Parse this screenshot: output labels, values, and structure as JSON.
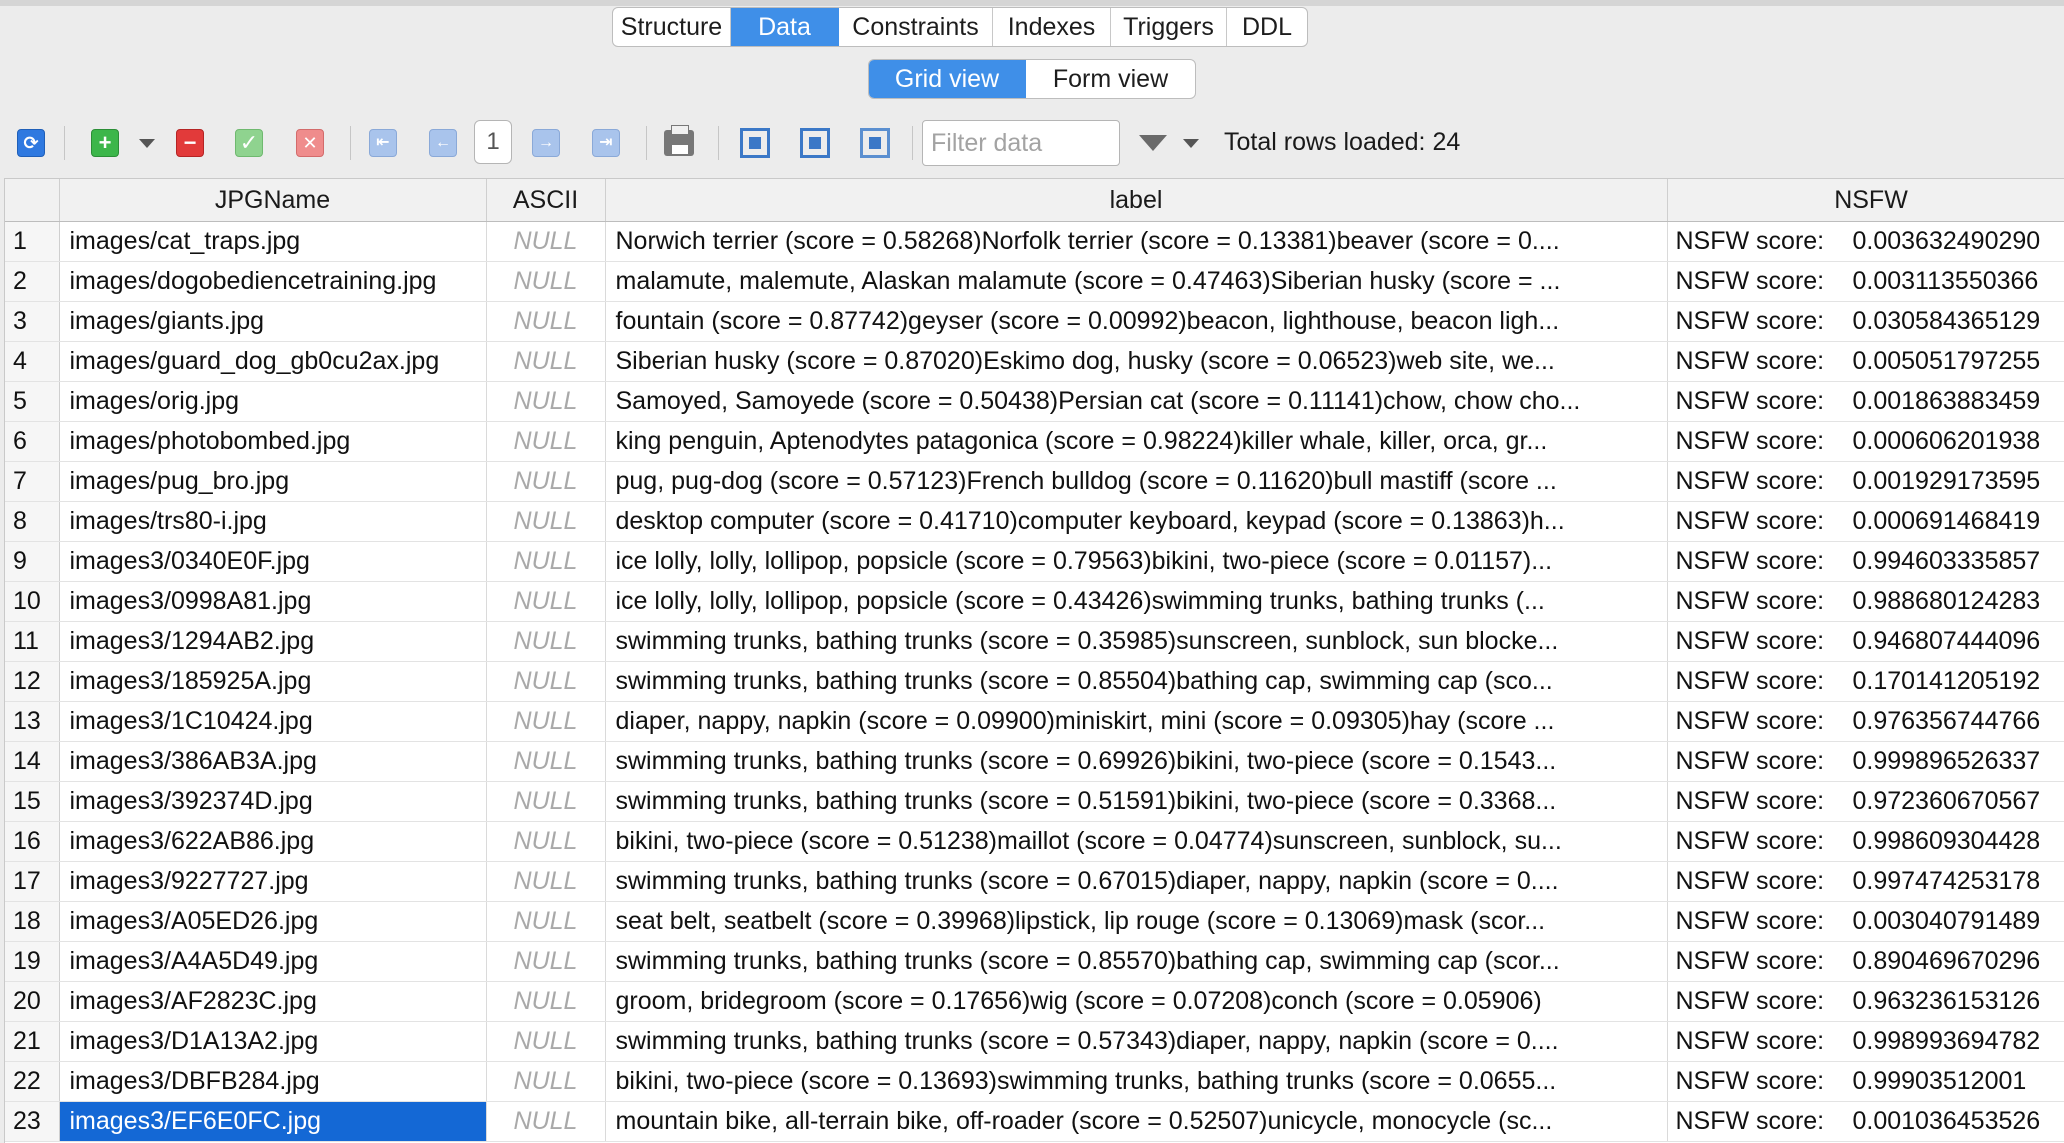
{
  "tabs": [
    {
      "label": "Structure",
      "active": false
    },
    {
      "label": "Data",
      "active": true
    },
    {
      "label": "Constraints",
      "active": false
    },
    {
      "label": "Indexes",
      "active": false
    },
    {
      "label": "Triggers",
      "active": false
    },
    {
      "label": "DDL",
      "active": false
    }
  ],
  "views": [
    {
      "label": "Grid view",
      "active": true
    },
    {
      "label": "Form view",
      "active": false
    }
  ],
  "toolbar": {
    "page_number": "1",
    "filter_placeholder": "Filter data",
    "rows_loaded": "Total rows loaded: 24"
  },
  "colors": {
    "accent": "#3f8fe8",
    "selection": "#1468d5"
  },
  "columns": [
    "JPGName",
    "ASCII",
    "label",
    "NSFW"
  ],
  "nsfw_prefix": "NSFW score:",
  "rows": [
    {
      "n": "1",
      "name": "images/cat_traps.jpg",
      "ascii": "NULL",
      "label": "Norwich terrier (score = 0.58268)Norfolk terrier (score = 0.13381)beaver (score = 0....",
      "nsfw": "0.003632490290"
    },
    {
      "n": "2",
      "name": "images/dogobediencetraining.jpg",
      "ascii": "NULL",
      "label": "malamute, malemute, Alaskan malamute (score = 0.47463)Siberian husky (score = ...",
      "nsfw": "0.003113550366"
    },
    {
      "n": "3",
      "name": "images/giants.jpg",
      "ascii": "NULL",
      "label": "fountain (score = 0.87742)geyser (score = 0.00992)beacon, lighthouse, beacon ligh...",
      "nsfw": "0.030584365129"
    },
    {
      "n": "4",
      "name": "images/guard_dog_gb0cu2ax.jpg",
      "ascii": "NULL",
      "label": "Siberian husky (score = 0.87020)Eskimo dog, husky (score = 0.06523)web site, we...",
      "nsfw": "0.005051797255"
    },
    {
      "n": "5",
      "name": "images/orig.jpg",
      "ascii": "NULL",
      "label": "Samoyed, Samoyede (score = 0.50438)Persian cat (score = 0.11141)chow, chow cho...",
      "nsfw": "0.001863883459"
    },
    {
      "n": "6",
      "name": "images/photobombed.jpg",
      "ascii": "NULL",
      "label": "king penguin, Aptenodytes patagonica (score = 0.98224)killer whale, killer, orca, gr...",
      "nsfw": "0.000606201938"
    },
    {
      "n": "7",
      "name": "images/pug_bro.jpg",
      "ascii": "NULL",
      "label": "pug, pug-dog (score = 0.57123)French bulldog (score = 0.11620)bull mastiff (score ...",
      "nsfw": "0.001929173595"
    },
    {
      "n": "8",
      "name": "images/trs80-i.jpg",
      "ascii": "NULL",
      "label": "desktop computer (score = 0.41710)computer keyboard, keypad (score = 0.13863)h...",
      "nsfw": "0.000691468419"
    },
    {
      "n": "9",
      "name": "images3/0340E0F.jpg",
      "ascii": "NULL",
      "label": "ice lolly, lolly, lollipop, popsicle (score = 0.79563)bikini, two-piece (score = 0.01157)...",
      "nsfw": "0.994603335857"
    },
    {
      "n": "10",
      "name": "images3/0998A81.jpg",
      "ascii": "NULL",
      "label": "ice lolly, lolly, lollipop, popsicle (score = 0.43426)swimming trunks, bathing trunks (...",
      "nsfw": "0.988680124283"
    },
    {
      "n": "11",
      "name": "images3/1294AB2.jpg",
      "ascii": "NULL",
      "label": "swimming trunks, bathing trunks (score = 0.35985)sunscreen, sunblock, sun blocke...",
      "nsfw": "0.946807444096"
    },
    {
      "n": "12",
      "name": "images3/185925A.jpg",
      "ascii": "NULL",
      "label": "swimming trunks, bathing trunks (score = 0.85504)bathing cap, swimming cap (sco...",
      "nsfw": "0.170141205192"
    },
    {
      "n": "13",
      "name": "images3/1C10424.jpg",
      "ascii": "NULL",
      "label": "diaper, nappy, napkin (score = 0.09900)miniskirt, mini (score = 0.09305)hay (score ...",
      "nsfw": "0.976356744766"
    },
    {
      "n": "14",
      "name": "images3/386AB3A.jpg",
      "ascii": "NULL",
      "label": "swimming trunks, bathing trunks (score = 0.69926)bikini, two-piece (score = 0.1543...",
      "nsfw": "0.999896526337"
    },
    {
      "n": "15",
      "name": "images3/392374D.jpg",
      "ascii": "NULL",
      "label": "swimming trunks, bathing trunks (score = 0.51591)bikini, two-piece (score = 0.3368...",
      "nsfw": "0.972360670567"
    },
    {
      "n": "16",
      "name": "images3/622AB86.jpg",
      "ascii": "NULL",
      "label": "bikini, two-piece (score = 0.51238)maillot (score = 0.04774)sunscreen, sunblock, su...",
      "nsfw": "0.998609304428"
    },
    {
      "n": "17",
      "name": "images3/9227727.jpg",
      "ascii": "NULL",
      "label": "swimming trunks, bathing trunks (score = 0.67015)diaper, nappy, napkin (score = 0....",
      "nsfw": "0.997474253178"
    },
    {
      "n": "18",
      "name": "images3/A05ED26.jpg",
      "ascii": "NULL",
      "label": "seat belt, seatbelt (score = 0.39968)lipstick, lip rouge (score = 0.13069)mask (scor...",
      "nsfw": "0.003040791489"
    },
    {
      "n": "19",
      "name": "images3/A4A5D49.jpg",
      "ascii": "NULL",
      "label": "swimming trunks, bathing trunks (score = 0.85570)bathing cap, swimming cap (scor...",
      "nsfw": "0.890469670296"
    },
    {
      "n": "20",
      "name": "images3/AF2823C.jpg",
      "ascii": "NULL",
      "label": "groom, bridegroom (score = 0.17656)wig (score = 0.07208)conch (score = 0.05906)",
      "nsfw": "0.963236153126"
    },
    {
      "n": "21",
      "name": "images3/D1A13A2.jpg",
      "ascii": "NULL",
      "label": "swimming trunks, bathing trunks (score = 0.57343)diaper, nappy, napkin (score = 0....",
      "nsfw": "0.998993694782"
    },
    {
      "n": "22",
      "name": "images3/DBFB284.jpg",
      "ascii": "NULL",
      "label": "bikini, two-piece (score = 0.13693)swimming trunks, bathing trunks (score = 0.0655...",
      "nsfw": "0.99903512001"
    },
    {
      "n": "23",
      "name": "images3/EF6E0FC.jpg",
      "ascii": "NULL",
      "label": "mountain bike, all-terrain bike, off-roader (score = 0.52507)unicycle, monocycle (sc...",
      "nsfw": "0.001036453526",
      "selected": true
    }
  ]
}
